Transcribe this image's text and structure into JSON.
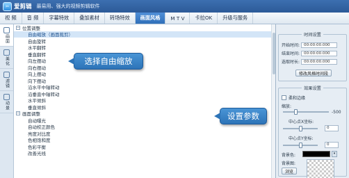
{
  "app": {
    "name": "爱剪辑",
    "slogan": "最易用、强大的视频剪辑软件"
  },
  "menu": {
    "tabs": [
      "视 频",
      "音 频",
      "字幕特效",
      "叠加素材",
      "转场特效",
      "画面风格",
      "M T V",
      "卡拉OK",
      "升级与服务"
    ]
  },
  "sidenav": [
    "画面",
    "美化",
    "滤镜",
    "动景"
  ],
  "effects": {
    "groups": [
      {
        "name": "位置调整",
        "items": [
          "自由缩放（画面裁剪）",
          "自由旋转",
          "水平翻转",
          "垂直翻转",
          "向左摆动",
          "向右摆动",
          "向上摆动",
          "向下摆动",
          "沿水平中轴转动",
          "沿垂直中轴转动",
          "水平倾斜",
          "垂直倾斜"
        ]
      },
      {
        "name": "画面调整",
        "items": [
          "自动曝光",
          "自动校正颜色",
          "亮度对比度",
          "色相饱和度",
          "色彩平衡",
          "改善光线"
        ]
      }
    ]
  },
  "callouts": {
    "select_zoom": "选择自由缩放",
    "set_params": "设置参数"
  },
  "props": {
    "time_section": {
      "title": "时间设置",
      "start_label": "开始时间:",
      "start_value": "00:00:00.000",
      "end_label": "结束时间:",
      "end_value": "00:00:00.000",
      "duration_label": "选取时长:",
      "duration_value": "00:00:00.000",
      "modify_button": "修改风格时间段"
    },
    "effect_section": {
      "title": "效果设置",
      "soft_border": "柔和边缘",
      "zoom_label": "缩放:",
      "zoom_value": "-500",
      "center_x_label": "中心点X坐标:",
      "center_x_value": "0",
      "center_y_label": "中心点Y坐标:",
      "center_y_value": "0",
      "bg_color_label": "背景色:",
      "bg_image_label": "背景图:",
      "browse_button": "浏览"
    }
  }
}
